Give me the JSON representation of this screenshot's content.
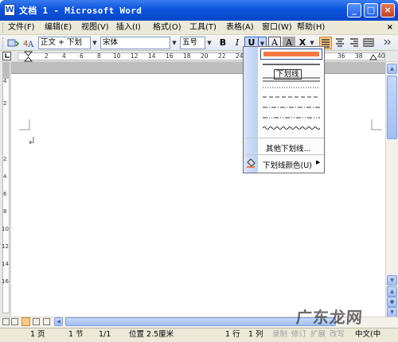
{
  "window": {
    "title": "文档 1 - Microsoft Word",
    "icon": "W",
    "minimize": "_",
    "maximize": "□",
    "close": "×"
  },
  "menu": [
    "文件(F)",
    "编辑(E)",
    "视图(V)",
    "插入(I)",
    "格式(O)",
    "工具(T)",
    "表格(A)",
    "窗口(W)",
    "帮助(H)"
  ],
  "menu_close": "×",
  "toolbar": {
    "style_value": "正文 + 下划",
    "font_value": "宋体",
    "size_value": "五号",
    "bold": "B",
    "italic": "I",
    "underline": "U",
    "char_border": "A",
    "char_shade": "A",
    "char_scale": "X"
  },
  "ruler": {
    "numbers": [
      "2",
      "4",
      "6",
      "8",
      "10",
      "12",
      "14",
      "16",
      "18",
      "20",
      "22",
      "24",
      "26",
      "36",
      "38",
      "40"
    ]
  },
  "vruler": {
    "numbers": [
      "4",
      "2",
      "2",
      "4",
      "6",
      "8",
      "10",
      "12",
      "14",
      "16"
    ]
  },
  "underline_menu": {
    "items": [
      "solid-thick",
      "word-only",
      "single",
      "dotted",
      "dashed-short",
      "dash-dot",
      "dash-dot-dot",
      "double-dash",
      "wave"
    ],
    "word_sample": "下划线",
    "more_label": "其他下划线...",
    "color_label": "下划线颜色(U)",
    "selected_color": "#f37840"
  },
  "status": {
    "page": "1 页",
    "section": "1 节",
    "fraction": "1/1",
    "position": "位置 2.5厘米",
    "line": "1 行",
    "column": "1 列",
    "rec": "录制",
    "trk": "修订",
    "ext": "扩展",
    "ovr": "改写",
    "lang": "中文(中"
  },
  "watermark": "广东龙网"
}
